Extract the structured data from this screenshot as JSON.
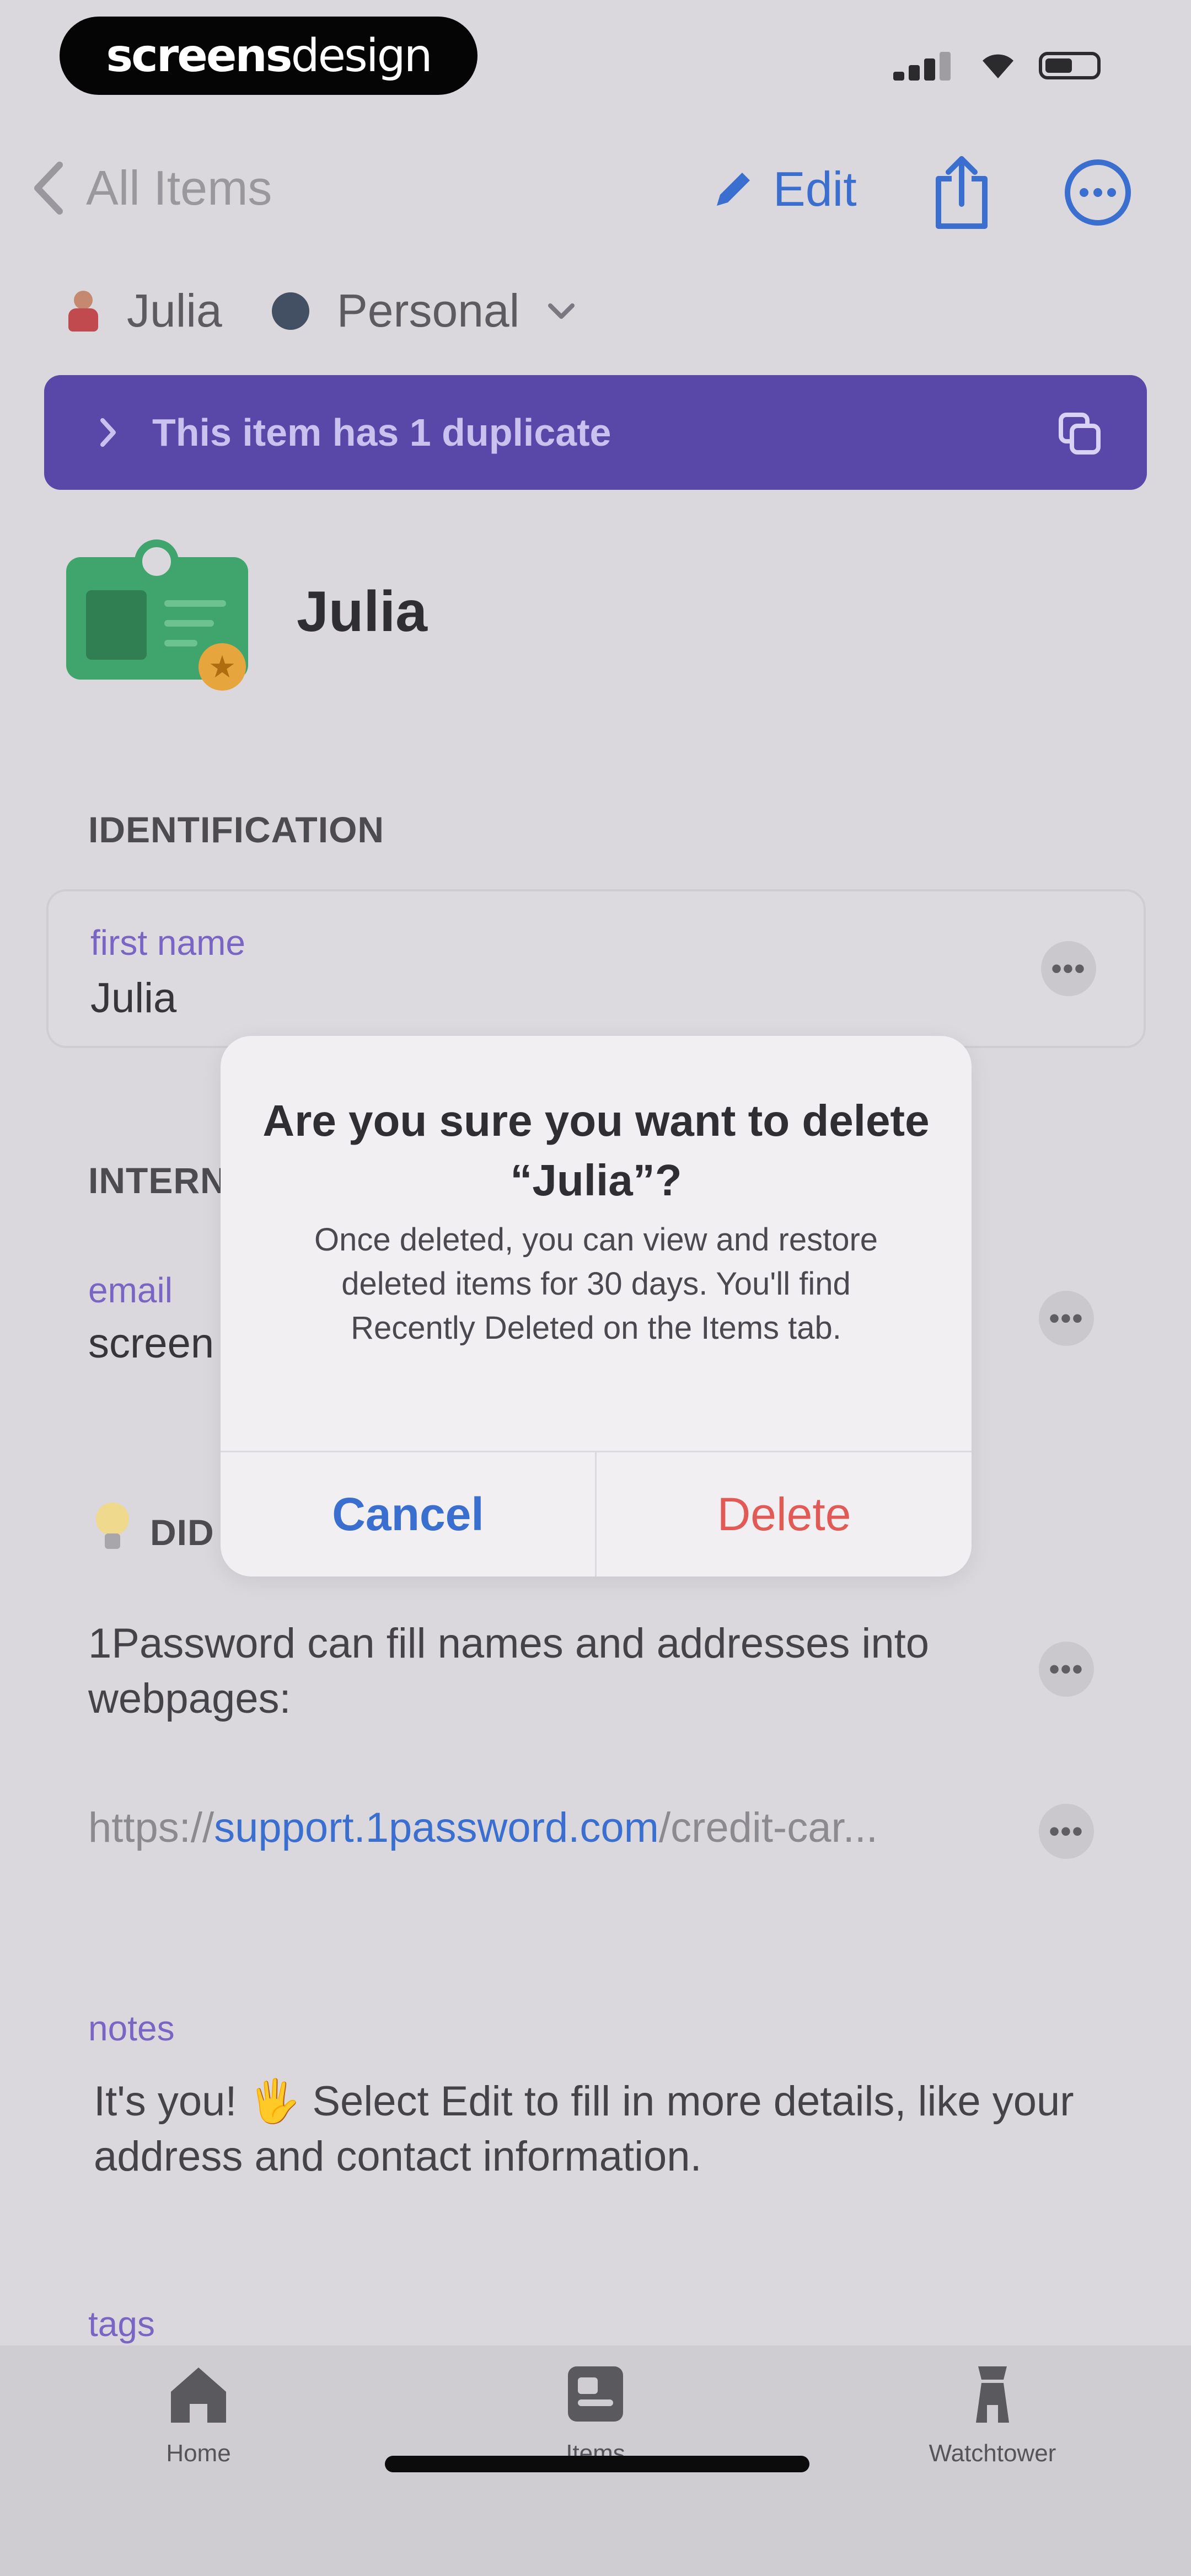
{
  "status_bar": {
    "brand_bold": "screens",
    "brand_light": "design"
  },
  "nav": {
    "back_label": "All Items",
    "edit_label": "Edit"
  },
  "account": {
    "user_name": "Julia",
    "vault_name": "Personal"
  },
  "banner": {
    "text": "This item has 1 duplicate"
  },
  "item": {
    "title": "Julia",
    "section_identification": "IDENTIFICATION",
    "first_name_label": "first name",
    "first_name_value": "Julia",
    "section_internet": "INTERN",
    "email_label": "email",
    "email_value": "screen",
    "did_you_know_heading": "DID",
    "tip_text": "1Password can fill names and addresses into webpages:",
    "url_prefix": "https://",
    "url_link": "support.1password.com",
    "url_suffix": "/credit-car...",
    "notes_label": "notes",
    "notes_text": "It's you! 🖐 Select Edit to fill in more details, like your address and contact information.",
    "tags_label": "tags"
  },
  "alert": {
    "title": "Are you sure you want to delete “Julia”?",
    "message": "Once deleted, you can view and restore deleted items for 30 days. You'll find Recently Deleted on the Items tab.",
    "cancel_label": "Cancel",
    "delete_label": "Delete"
  },
  "tabs": [
    {
      "label": "Home"
    },
    {
      "label": "Items"
    },
    {
      "label": "Watchtower"
    }
  ],
  "colors": {
    "accent": "#3a6fd0",
    "banner": "#5a48a9",
    "destructive": "#e25a55",
    "label_purple": "#7865c4"
  }
}
